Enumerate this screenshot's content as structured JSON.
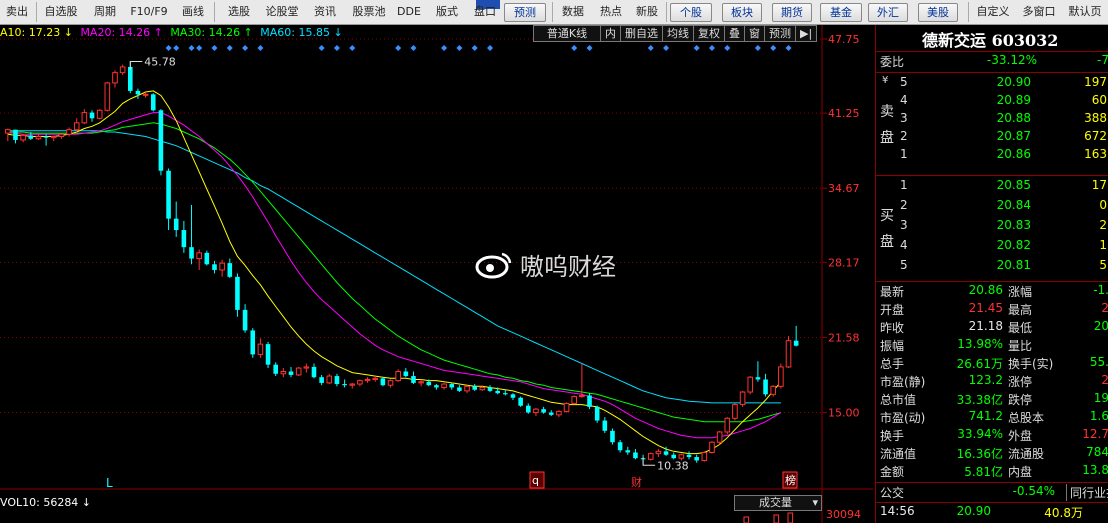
{
  "toolbar": {
    "items": [
      "卖出",
      "自选股",
      "周期",
      "F10/F9",
      "画线",
      "选股",
      "论股堂",
      "资讯",
      "股票池",
      "DDE",
      "版式",
      "盘口",
      "预测",
      "数据",
      "热点",
      "新股",
      "个股",
      "板块",
      "期货",
      "基金",
      "外汇",
      "美股",
      "自定义",
      "多窗口",
      "默认页"
    ]
  },
  "colors": {
    "up": "#ff3232",
    "down": "#00ffff",
    "ma10": "#ffff00",
    "ma20": "#ff00ff",
    "ma30": "#00ff00",
    "ma60": "#00e0ff",
    "axis": "#8b0000",
    "price_labels": "#ff3232",
    "quote_green": "#00ff00"
  },
  "legend": {
    "ma10": "A10: 17.23 ↓",
    "ma20": "MA20: 14.26 ↑",
    "ma30": "MA30: 14.26 ↑",
    "ma60": "MA60: 15.85 ↓"
  },
  "chart_menu": [
    "普通K线",
    "内",
    "删自选",
    "均线",
    "复权",
    "叠",
    "窗",
    "预测",
    "▶|"
  ],
  "price_axis": [
    "47.75",
    "41.25",
    "34.67",
    "28.17",
    "21.58",
    "15.00"
  ],
  "markers": {
    "high": "45.78",
    "low": "10.38",
    "l_label": "L",
    "q_label": "q",
    "cai_label": "财",
    "bang_label": "榜"
  },
  "watermark": "嗷呜财经",
  "volume": {
    "label": "VOL10: 56284 ↓",
    "selector": "成交量",
    "axis_value": "30094"
  },
  "chart_data": {
    "type": "candlestick",
    "y_axis_ticks": [
      47.75,
      41.25,
      34.67,
      28.17,
      21.58,
      15.0
    ],
    "ylim": [
      9.0,
      47.75
    ],
    "candles": [
      [
        39.5,
        39.9,
        38.8,
        39.8
      ],
      [
        39.8,
        39.8,
        38.6,
        38.9
      ],
      [
        38.9,
        39.4,
        38.7,
        39.3
      ],
      [
        39.3,
        39.6,
        38.9,
        39.0
      ],
      [
        39.0,
        39.4,
        38.9,
        39.2
      ],
      [
        39.2,
        39.4,
        38.4,
        39.1
      ],
      [
        39.1,
        39.3,
        38.8,
        39.2
      ],
      [
        39.2,
        39.5,
        39.0,
        39.4
      ],
      [
        39.4,
        40.0,
        39.2,
        39.8
      ],
      [
        39.8,
        40.8,
        39.5,
        40.4
      ],
      [
        40.4,
        41.6,
        40.3,
        41.3
      ],
      [
        41.3,
        41.5,
        40.5,
        40.8
      ],
      [
        40.8,
        41.6,
        40.7,
        41.5
      ],
      [
        41.5,
        44.0,
        41.4,
        43.9
      ],
      [
        43.9,
        45.0,
        43.5,
        44.8
      ],
      [
        44.8,
        45.5,
        44.6,
        45.3
      ],
      [
        45.3,
        45.78,
        43.0,
        43.2
      ],
      [
        43.2,
        43.4,
        42.5,
        42.9
      ],
      [
        42.9,
        43.1,
        42.6,
        42.9
      ],
      [
        42.9,
        43.0,
        41.4,
        41.5
      ],
      [
        41.5,
        41.6,
        35.8,
        36.2
      ],
      [
        36.2,
        36.4,
        31.0,
        32.0
      ],
      [
        32.0,
        33.5,
        30.4,
        31.0
      ],
      [
        31.0,
        31.8,
        29.0,
        29.5
      ],
      [
        29.5,
        33.2,
        28.0,
        28.5
      ],
      [
        28.5,
        29.3,
        27.5,
        29.0
      ],
      [
        29.0,
        29.2,
        27.9,
        28.0
      ],
      [
        28.0,
        28.3,
        27.2,
        27.5
      ],
      [
        27.5,
        28.4,
        26.9,
        28.1
      ],
      [
        28.1,
        28.5,
        26.8,
        26.9
      ],
      [
        26.9,
        27.2,
        23.4,
        24.0
      ],
      [
        24.0,
        24.5,
        22.0,
        22.2
      ],
      [
        22.2,
        22.4,
        19.8,
        20.1
      ],
      [
        20.1,
        21.5,
        19.8,
        21.0
      ],
      [
        21.0,
        21.2,
        18.9,
        19.2
      ],
      [
        19.2,
        19.4,
        18.2,
        18.4
      ],
      [
        18.4,
        18.9,
        18.1,
        18.6
      ],
      [
        18.6,
        19.0,
        18.1,
        18.3
      ],
      [
        18.3,
        19.0,
        18.2,
        18.9
      ],
      [
        18.9,
        19.3,
        18.5,
        19.0
      ],
      [
        19.0,
        19.3,
        18.0,
        18.1
      ],
      [
        18.1,
        18.3,
        17.4,
        17.6
      ],
      [
        17.6,
        18.4,
        17.5,
        18.2
      ],
      [
        18.2,
        18.4,
        17.3,
        17.5
      ],
      [
        17.5,
        17.9,
        17.2,
        17.4
      ],
      [
        17.4,
        17.6,
        17.1,
        17.5
      ],
      [
        17.5,
        17.9,
        17.3,
        17.8
      ],
      [
        17.8,
        18.1,
        17.6,
        17.9
      ],
      [
        17.9,
        18.2,
        17.7,
        18.0
      ],
      [
        18.0,
        18.1,
        17.3,
        17.4
      ],
      [
        17.4,
        17.9,
        17.2,
        17.8
      ],
      [
        17.8,
        18.8,
        17.7,
        18.6
      ],
      [
        18.6,
        18.9,
        18.1,
        18.2
      ],
      [
        18.2,
        18.6,
        17.5,
        17.6
      ],
      [
        17.6,
        17.9,
        17.3,
        17.7
      ],
      [
        17.7,
        17.9,
        17.3,
        17.4
      ],
      [
        17.4,
        17.5,
        17.0,
        17.2
      ],
      [
        17.2,
        17.6,
        17.0,
        17.5
      ],
      [
        17.5,
        17.6,
        17.0,
        17.2
      ],
      [
        17.2,
        17.4,
        16.8,
        16.9
      ],
      [
        16.9,
        17.4,
        16.7,
        17.3
      ],
      [
        17.3,
        17.5,
        16.9,
        17.0
      ],
      [
        17.0,
        17.3,
        16.9,
        17.2
      ],
      [
        17.2,
        17.4,
        16.8,
        16.9
      ],
      [
        16.9,
        17.2,
        16.6,
        16.7
      ],
      [
        16.7,
        17.0,
        16.5,
        16.6
      ],
      [
        16.6,
        16.7,
        16.1,
        16.3
      ],
      [
        16.3,
        16.4,
        15.5,
        15.6
      ],
      [
        15.6,
        15.8,
        14.9,
        15.0
      ],
      [
        15.0,
        15.4,
        14.7,
        15.3
      ],
      [
        15.3,
        15.5,
        14.9,
        15.0
      ],
      [
        15.0,
        15.2,
        14.7,
        14.8
      ],
      [
        14.8,
        15.2,
        14.6,
        15.1
      ],
      [
        15.1,
        15.9,
        15.0,
        15.8
      ],
      [
        15.8,
        16.5,
        15.7,
        16.4
      ],
      [
        16.4,
        19.3,
        16.3,
        16.5
      ],
      [
        16.5,
        16.7,
        15.3,
        15.5
      ],
      [
        15.5,
        15.6,
        14.1,
        14.3
      ],
      [
        14.3,
        14.6,
        13.2,
        13.4
      ],
      [
        13.4,
        13.6,
        12.2,
        12.4
      ],
      [
        12.4,
        12.6,
        11.5,
        11.7
      ],
      [
        11.7,
        12.0,
        11.3,
        11.5
      ],
      [
        11.5,
        11.8,
        10.9,
        11.0
      ],
      [
        11.0,
        11.3,
        10.38,
        10.9
      ],
      [
        10.9,
        11.5,
        10.8,
        11.4
      ],
      [
        11.4,
        11.8,
        11.1,
        11.6
      ],
      [
        11.6,
        12.0,
        11.2,
        11.3
      ],
      [
        11.3,
        11.5,
        10.9,
        11.0
      ],
      [
        11.0,
        11.4,
        10.8,
        11.3
      ],
      [
        11.3,
        11.6,
        10.9,
        11.1
      ],
      [
        11.1,
        11.3,
        10.6,
        10.8
      ],
      [
        10.8,
        11.6,
        10.7,
        11.5
      ],
      [
        11.5,
        12.5,
        11.4,
        12.4
      ],
      [
        12.4,
        13.4,
        12.2,
        13.3
      ],
      [
        13.3,
        14.6,
        13.1,
        14.5
      ],
      [
        14.5,
        15.8,
        14.3,
        15.7
      ],
      [
        15.7,
        16.9,
        15.5,
        16.8
      ],
      [
        16.8,
        18.2,
        16.6,
        18.1
      ],
      [
        18.1,
        19.5,
        17.7,
        17.9
      ],
      [
        17.9,
        18.4,
        16.4,
        16.6
      ],
      [
        16.6,
        17.4,
        16.4,
        17.3
      ],
      [
        17.3,
        19.3,
        17.1,
        19.0
      ],
      [
        19.0,
        21.7,
        18.9,
        21.3
      ],
      [
        21.3,
        22.6,
        20.8,
        20.86
      ]
    ],
    "ma10": [
      39.4,
      39.3,
      39.3,
      39.2,
      39.2,
      39.2,
      39.2,
      39.3,
      39.4,
      39.6,
      39.9,
      40.1,
      40.4,
      40.9,
      41.4,
      42.1,
      42.5,
      42.8,
      43.1,
      43.2,
      42.8,
      41.8,
      40.6,
      39.1,
      37.6,
      36.1,
      34.6,
      33.1,
      31.6,
      30.0,
      28.7,
      27.9,
      27.0,
      26.2,
      25.2,
      24.3,
      23.4,
      22.5,
      21.7,
      21.0,
      20.4,
      19.9,
      19.5,
      19.1,
      18.8,
      18.5,
      18.4,
      18.3,
      18.2,
      18.1,
      18.0,
      18.0,
      18.0,
      17.9,
      17.9,
      17.8,
      17.8,
      17.7,
      17.6,
      17.5,
      17.4,
      17.3,
      17.3,
      17.2,
      17.1,
      17.0,
      16.9,
      16.7,
      16.5,
      16.3,
      16.1,
      15.9,
      15.8,
      15.7,
      15.7,
      15.7,
      15.6,
      15.5,
      15.2,
      14.8,
      14.4,
      13.9,
      13.4,
      12.9,
      12.5,
      12.1,
      11.8,
      11.6,
      11.5,
      11.4,
      11.4,
      11.5,
      11.8,
      12.2,
      12.8,
      13.5,
      14.2,
      14.8,
      15.4,
      16.1,
      16.9,
      17.7
    ],
    "ma20": [
      39.5,
      39.5,
      39.4,
      39.4,
      39.4,
      39.4,
      39.4,
      39.4,
      39.4,
      39.4,
      39.5,
      39.6,
      39.7,
      39.9,
      40.2,
      40.5,
      40.7,
      40.9,
      41.1,
      41.3,
      41.3,
      41.0,
      40.6,
      40.2,
      39.7,
      39.2,
      38.6,
      38.0,
      37.4,
      36.6,
      35.8,
      34.9,
      33.9,
      32.8,
      31.7,
      30.5,
      29.4,
      28.3,
      27.3,
      26.4,
      25.6,
      24.9,
      24.3,
      23.7,
      23.1,
      22.5,
      21.9,
      21.4,
      20.9,
      20.5,
      20.2,
      19.9,
      19.7,
      19.5,
      19.3,
      19.1,
      18.9,
      18.7,
      18.6,
      18.5,
      18.4,
      18.3,
      18.2,
      18.1,
      18.0,
      17.9,
      17.8,
      17.7,
      17.5,
      17.3,
      17.1,
      17.0,
      16.9,
      16.8,
      16.7,
      16.6,
      16.4,
      16.2,
      16.0,
      15.7,
      15.3,
      14.9,
      14.5,
      14.2,
      13.9,
      13.6,
      13.4,
      13.2,
      13.0,
      12.9,
      12.8,
      12.8,
      12.8,
      12.9,
      13.0,
      13.2,
      13.4,
      13.6,
      13.9,
      14.2,
      14.6,
      15.0
    ],
    "ma30": [
      39.6,
      39.6,
      39.6,
      39.5,
      39.5,
      39.5,
      39.5,
      39.5,
      39.5,
      39.5,
      39.5,
      39.5,
      39.6,
      39.7,
      39.8,
      40.0,
      40.1,
      40.2,
      40.3,
      40.4,
      40.3,
      40.1,
      39.9,
      39.6,
      39.3,
      39.0,
      38.6,
      38.2,
      37.7,
      37.2,
      36.6,
      35.9,
      35.2,
      34.4,
      33.6,
      32.8,
      32.0,
      31.2,
      30.4,
      29.6,
      28.8,
      28.0,
      27.2,
      26.4,
      25.7,
      25.0,
      24.4,
      23.8,
      23.2,
      22.7,
      22.2,
      21.7,
      21.3,
      20.9,
      20.5,
      20.2,
      19.9,
      19.6,
      19.4,
      19.2,
      19.0,
      18.8,
      18.6,
      18.4,
      18.3,
      18.1,
      18.0,
      17.8,
      17.7,
      17.5,
      17.4,
      17.2,
      17.1,
      17.0,
      16.9,
      16.8,
      16.7,
      16.6,
      16.4,
      16.2,
      16.0,
      15.8,
      15.6,
      15.4,
      15.2,
      15.0,
      14.8,
      14.6,
      14.5,
      14.4,
      14.3,
      14.2,
      14.2,
      14.2,
      14.2,
      14.2,
      14.2,
      14.3,
      14.4,
      14.6,
      14.8,
      15.0
    ],
    "ma60": [
      39.7,
      39.7,
      39.7,
      39.7,
      39.7,
      39.7,
      39.7,
      39.7,
      39.7,
      39.7,
      39.7,
      39.7,
      39.7,
      39.6,
      39.6,
      39.5,
      39.4,
      39.3,
      39.2,
      39.0,
      38.8,
      38.6,
      38.4,
      38.1,
      37.8,
      37.5,
      37.2,
      36.9,
      36.6,
      36.3,
      36.0,
      35.6,
      35.3,
      34.9,
      34.6,
      34.2,
      33.8,
      33.4,
      33.0,
      32.6,
      32.2,
      31.8,
      31.4,
      31.0,
      30.6,
      30.2,
      29.8,
      29.4,
      29.0,
      28.6,
      28.2,
      27.8,
      27.4,
      27.0,
      26.6,
      26.2,
      25.8,
      25.4,
      25.0,
      24.6,
      24.2,
      23.8,
      23.4,
      23.0,
      22.6,
      22.3,
      22.0,
      21.7,
      21.4,
      21.1,
      20.8,
      20.5,
      20.2,
      19.9,
      19.6,
      19.3,
      19.0,
      18.7,
      18.4,
      18.1,
      17.8,
      17.5,
      17.2,
      16.9,
      16.7,
      16.5,
      16.3,
      16.2,
      16.1,
      16.0,
      15.95,
      15.9,
      15.85,
      15.85,
      15.85,
      15.85,
      15.85,
      15.85,
      15.85,
      15.85,
      15.85,
      15.85
    ],
    "signal_marker_indices": [
      21,
      22,
      24,
      25,
      27,
      29,
      31,
      33,
      41,
      43,
      45,
      51,
      53,
      57,
      59,
      61,
      63,
      74,
      76,
      84,
      86,
      90,
      92,
      94,
      98,
      100,
      102
    ]
  },
  "quote": {
    "stock_title": "德新交运 603032",
    "weibi_label": "委比",
    "weibi_value": "-33.12%",
    "weibi_extra": "-7",
    "sell_side_label": [
      "卖",
      "盘"
    ],
    "buy_side_label": [
      "买",
      "盘"
    ],
    "asks": [
      {
        "level": "5",
        "price": "20.90",
        "vol": "197"
      },
      {
        "level": "4",
        "price": "20.89",
        "vol": "60"
      },
      {
        "level": "3",
        "price": "20.88",
        "vol": "388"
      },
      {
        "level": "2",
        "price": "20.87",
        "vol": "672"
      },
      {
        "level": "1",
        "price": "20.86",
        "vol": "163"
      }
    ],
    "bids": [
      {
        "level": "1",
        "price": "20.85",
        "vol": "17"
      },
      {
        "level": "2",
        "price": "20.84",
        "vol": "0"
      },
      {
        "level": "3",
        "price": "20.83",
        "vol": "2"
      },
      {
        "level": "4",
        "price": "20.82",
        "vol": "1"
      },
      {
        "level": "5",
        "price": "20.81",
        "vol": "5"
      }
    ],
    "stats": [
      {
        "l1": "最新",
        "v1": "20.86",
        "c1": "green",
        "l2": "涨幅",
        "v2": "-1.",
        "c2": "green"
      },
      {
        "l1": "开盘",
        "v1": "21.45",
        "c1": "red",
        "l2": "最高",
        "v2": "2",
        "c2": "red"
      },
      {
        "l1": "昨收",
        "v1": "21.18",
        "c1": "white",
        "l2": "最低",
        "v2": "20",
        "c2": "green"
      },
      {
        "l1": "振幅",
        "v1": "13.98%",
        "c1": "green",
        "l2": "量比",
        "v2": "",
        "c2": "white"
      },
      {
        "l1": "总手",
        "v1": "26.61万",
        "c1": "green",
        "l2": "换手(实)",
        "v2": "55.",
        "c2": "green"
      },
      {
        "l1": "市盈(静)",
        "v1": "123.2",
        "c1": "green",
        "l2": "涨停",
        "v2": "2",
        "c2": "red"
      },
      {
        "l1": "总市值",
        "v1": "33.38亿",
        "c1": "green",
        "l2": "跌停",
        "v2": "19",
        "c2": "green"
      },
      {
        "l1": "市盈(动)",
        "v1": "741.2",
        "c1": "green",
        "l2": "总股本",
        "v2": "1.6",
        "c2": "green"
      },
      {
        "l1": "换手",
        "v1": "33.94%",
        "c1": "green",
        "l2": "外盘",
        "v2": "12.7",
        "c2": "red"
      },
      {
        "l1": "流通值",
        "v1": "16.36亿",
        "c1": "green",
        "l2": "流通股",
        "v2": "784",
        "c2": "green"
      },
      {
        "l1": "金额",
        "v1": "5.81亿",
        "c1": "green",
        "l2": "内盘",
        "v2": "13.8",
        "c2": "green"
      }
    ],
    "footer_tab_left": "公交",
    "footer_tab_pct": "-0.54%",
    "footer_tab_right": "同行业排",
    "tick_time": "14:56",
    "tick_price": "20.90",
    "tick_vol": "40.8万"
  }
}
